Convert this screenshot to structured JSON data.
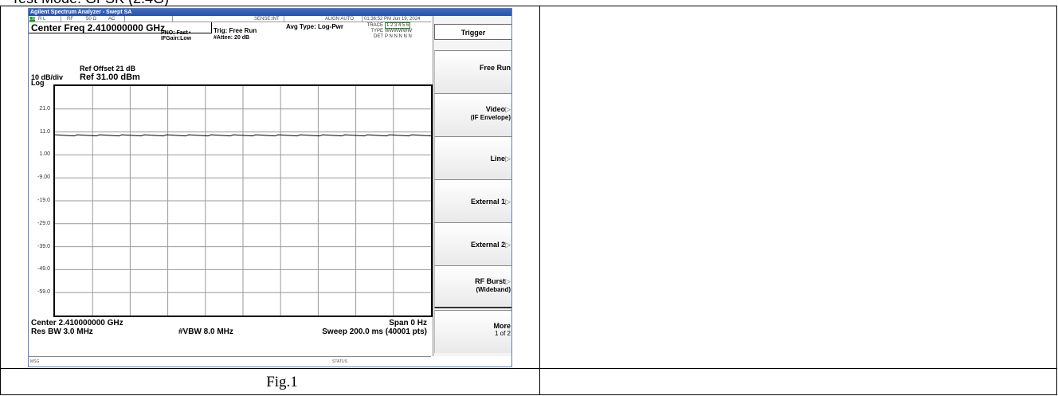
{
  "document": {
    "top_caption": "Test Mode: GFSK (2.4G)",
    "figure_caption": "Fig.1"
  },
  "analyzer": {
    "window_title": "Agilent Spectrum Analyzer - Swept SA",
    "status": {
      "rl_badge": "LXI",
      "rl": "R L",
      "rf": "RF",
      "impedance": "50 Ω",
      "coupling": "AC",
      "sense": "SENSE:INT",
      "align": "ALIGN AUTO",
      "datetime": "01:36:52 PM Jun 19, 2024"
    },
    "center_freq": "Center Freq 2.410000000 GHz",
    "pno": "PNO: Fast",
    "ifgain": "IFGain:Low",
    "trig": "Trig: Free Run",
    "atten": "#Atten: 20 dB",
    "avg_type": "Avg Type: Log-Pwr",
    "trace_table": {
      "trace_label": "TRACE",
      "trace_values": "1 2 3 4 5 6",
      "type_label": "TYPE",
      "type_values": "WWWWWW",
      "det_label": "DET",
      "det_values": "P N N N N N"
    },
    "ref_offset": "Ref Offset 21 dB",
    "ref_level": "Ref 31.00 dBm",
    "scale": "10 dB/div",
    "scale_type": "Log",
    "y_tick_labels": [
      "21.0",
      "11.0",
      "1.00",
      "-9.00",
      "-19.0",
      "-29.0",
      "-39.0",
      "-49.0",
      "-59.0"
    ],
    "bottom": {
      "center": "Center 2.410000000 GHz",
      "span": "Span 0 Hz",
      "res_bw": "Res BW 3.0 MHz",
      "vbw": "#VBW 8.0 MHz",
      "sweep": "Sweep  200.0 ms (40001 pts)"
    },
    "msg_label": "MSG",
    "status_label": "STATUS",
    "trace": {
      "level_dbm": 9.5,
      "ref_dbm": 31,
      "db_per_div": 10,
      "divisions": 10,
      "color": "#000000"
    },
    "softkeys": {
      "title": "Trigger",
      "keys": [
        {
          "label": "Free Run",
          "sub": ""
        },
        {
          "label": "Video",
          "sub": "(IF Envelope)"
        },
        {
          "label": "Line",
          "sub": ""
        },
        {
          "label": "External 1",
          "sub": ""
        },
        {
          "label": "External 2",
          "sub": ""
        },
        {
          "label": "RF Burst",
          "sub": "(Wideband)"
        },
        {
          "label": "More",
          "sub": "1 of 2"
        }
      ]
    }
  }
}
